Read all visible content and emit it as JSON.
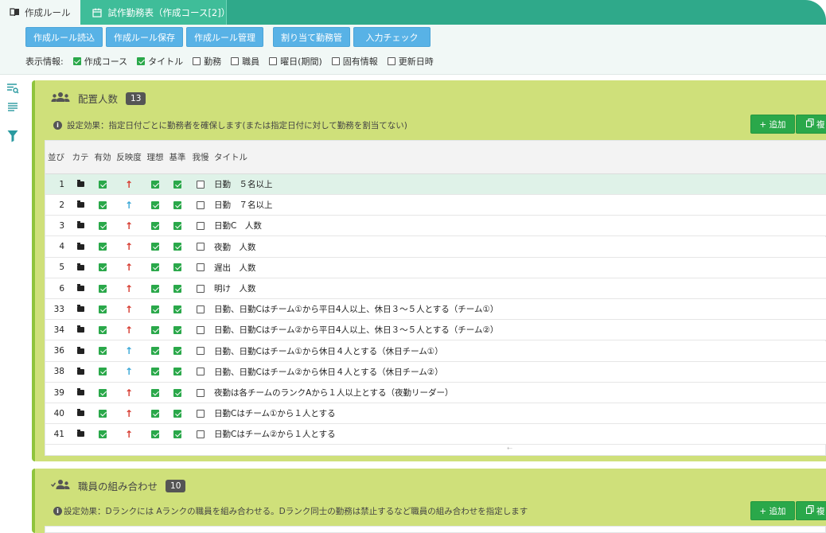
{
  "tabs": [
    {
      "label": "作成ルール",
      "icon": "book-icon",
      "active": true
    },
    {
      "label": "試作勤務表（作成コース[2]）",
      "icon": "calendar-icon",
      "active": false
    }
  ],
  "toolbar": {
    "buttons": [
      "作成ルール読込",
      "作成ルール保存",
      "作成ルール管理",
      "割り当て勤務管",
      "入力チェック"
    ],
    "display_label": "表示情報:",
    "display_options": [
      {
        "label": "作成コース",
        "checked": true
      },
      {
        "label": "タイトル",
        "checked": true
      },
      {
        "label": "勤務",
        "checked": false
      },
      {
        "label": "職員",
        "checked": false
      },
      {
        "label": "曜日(期間)",
        "checked": false
      },
      {
        "label": "固有情報",
        "checked": false
      },
      {
        "label": "更新日時",
        "checked": false
      }
    ]
  },
  "sidebar": {
    "icons": [
      "search-list-icon",
      "list-icon",
      "filter-icon"
    ]
  },
  "panel1": {
    "title": "配置人数",
    "count": "13",
    "effect": "設定効果：指定日付ごとに勤務者を確保します(または指定日付に対して勤務を割当てない)",
    "add_label": "+ 追加",
    "copy_label": "複",
    "columns": [
      "並び",
      "カテ",
      "有効",
      "反映度",
      "理想",
      "基準",
      "我慢",
      "タイトル"
    ],
    "rows": [
      {
        "num": "1",
        "arrow": "red",
        "title": "日勤　５名以上"
      },
      {
        "num": "2",
        "arrow": "blue",
        "title": "日勤　７名以上"
      },
      {
        "num": "3",
        "arrow": "red",
        "title": "日勤C　人数"
      },
      {
        "num": "4",
        "arrow": "red",
        "title": "夜勤　人数"
      },
      {
        "num": "5",
        "arrow": "red",
        "title": "遅出　人数"
      },
      {
        "num": "6",
        "arrow": "red",
        "title": "明け　人数"
      },
      {
        "num": "33",
        "arrow": "red",
        "title": "日勤、日勤Cはチーム①から平日4人以上、休日３～５人とする（チーム①）"
      },
      {
        "num": "34",
        "arrow": "red",
        "title": "日勤、日勤Cはチーム②から平日4人以上、休日３～５人とする（チーム②）"
      },
      {
        "num": "36",
        "arrow": "blue",
        "title": "日勤、日勤Cはチーム①から休日４人とする（休日チーム①）"
      },
      {
        "num": "38",
        "arrow": "blue",
        "title": "日勤、日勤Cはチーム②から休日４人とする（休日チーム②）"
      },
      {
        "num": "39",
        "arrow": "red",
        "title": "夜勤は各チームのランクAから１人以上とする（夜勤リーダー）"
      },
      {
        "num": "40",
        "arrow": "red",
        "title": "日勤Cはチーム①から１人とする"
      },
      {
        "num": "41",
        "arrow": "red",
        "title": "日勤Cはチーム②から１人とする"
      }
    ]
  },
  "panel2": {
    "title": "職員の組み合わせ",
    "count": "10",
    "effect": "設定効果：Dランクには Aランクの職員を組み合わせる。Dランク同士の勤務は禁止するなど職員の組み合わせを指定します",
    "add_label": "+ 追加",
    "copy_label": "複"
  },
  "colors": {
    "tab_bar": "#2fa98a",
    "button_blue": "#58b2e6",
    "panel_green": "#cfe07a",
    "add_green": "#2aa84a",
    "arrow_red": "#d63a2f",
    "arrow_blue": "#3aa7d6"
  }
}
